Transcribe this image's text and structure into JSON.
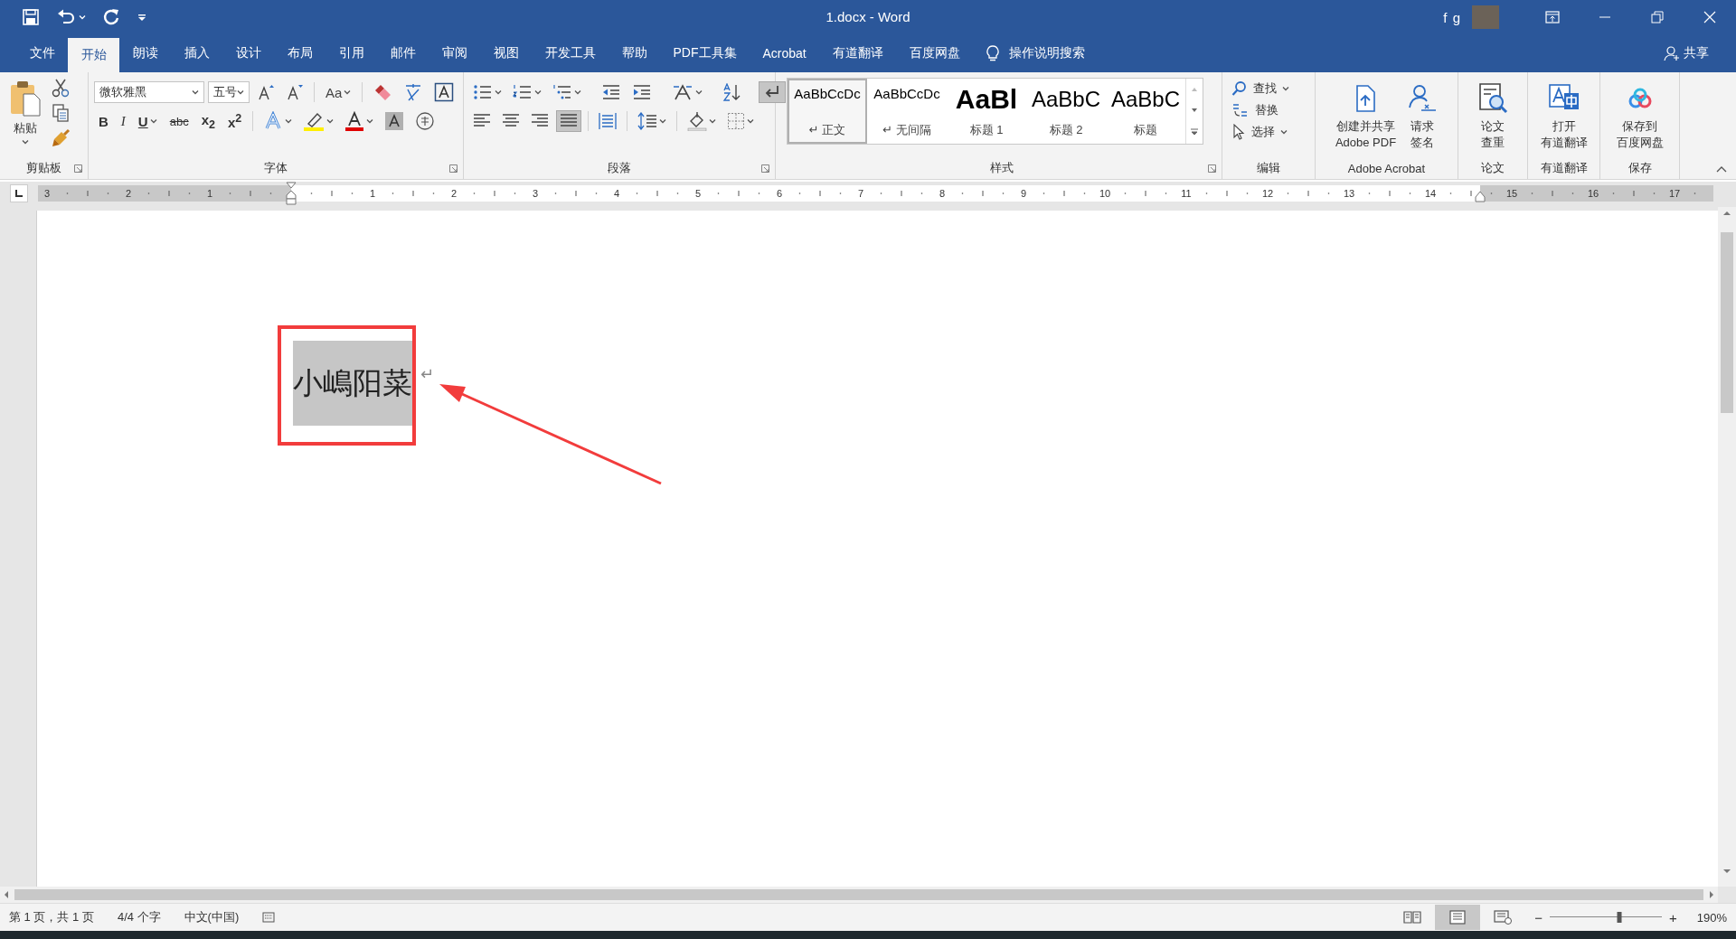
{
  "window": {
    "title": "1.docx  -  Word",
    "user": "f g"
  },
  "quick_access": [
    {
      "kind": "save"
    },
    {
      "kind": "undo"
    },
    {
      "kind": "redo"
    },
    {
      "kind": "customize"
    }
  ],
  "tabs": [
    {
      "label": "文件",
      "selected": false
    },
    {
      "label": "开始",
      "selected": true
    },
    {
      "label": "朗读",
      "selected": false
    },
    {
      "label": "插入",
      "selected": false
    },
    {
      "label": "设计",
      "selected": false
    },
    {
      "label": "布局",
      "selected": false
    },
    {
      "label": "引用",
      "selected": false
    },
    {
      "label": "邮件",
      "selected": false
    },
    {
      "label": "审阅",
      "selected": false
    },
    {
      "label": "视图",
      "selected": false
    },
    {
      "label": "开发工具",
      "selected": false
    },
    {
      "label": "帮助",
      "selected": false
    },
    {
      "label": "PDF工具集",
      "selected": false
    },
    {
      "label": "Acrobat",
      "selected": false
    },
    {
      "label": "有道翻译",
      "selected": false
    },
    {
      "label": "百度网盘",
      "selected": false
    }
  ],
  "tell_me": "操作说明搜索",
  "share": "共享",
  "clipboard": {
    "label": "剪贴板",
    "paste": "粘贴",
    "tools": [
      {
        "kind": "cut"
      },
      {
        "kind": "copy"
      },
      {
        "kind": "format-painter"
      }
    ]
  },
  "font": {
    "label": "字体",
    "name": "微软雅黑",
    "size": "五号",
    "case_button": "Aa",
    "row1": [
      {
        "kind": "grow"
      },
      {
        "kind": "shrink"
      }
    ],
    "row1b": [
      {
        "kind": "clear"
      },
      {
        "kind": "phonetic"
      },
      {
        "kind": "border"
      }
    ],
    "format_buttons": [
      {
        "kind": "bold",
        "text": "B"
      },
      {
        "kind": "italic",
        "text": "I"
      },
      {
        "kind": "underline",
        "text": "U"
      },
      {
        "kind": "strike",
        "text": "abc"
      },
      {
        "kind": "plain",
        "text": "x$_{2}$"
      },
      {
        "kind": "plain",
        "text": "x$^{2}$"
      }
    ],
    "row2": [
      {
        "kind": "effect"
      },
      {
        "kind": "highlight"
      },
      {
        "kind": "font-color"
      },
      {
        "kind": "shading"
      },
      {
        "kind": "enclose"
      }
    ]
  },
  "paragraph": {
    "label": "段落",
    "row1": [
      {
        "kind": "bullets",
        "pressed": false
      },
      {
        "kind": "numbering",
        "pressed": false
      },
      {
        "kind": "multilevel",
        "pressed": false
      },
      {
        "kind": "outdent",
        "pressed": false
      },
      {
        "kind": "indent",
        "pressed": false
      },
      {
        "kind": "asian",
        "pressed": false
      },
      {
        "kind": "sort",
        "pressed": false
      },
      {
        "kind": "marks",
        "pressed": true
      }
    ],
    "row2": [
      {
        "kind": "left",
        "pressed": false
      },
      {
        "kind": "center",
        "pressed": false
      },
      {
        "kind": "right",
        "pressed": false
      },
      {
        "kind": "justify",
        "pressed": true
      },
      {
        "kind": "distribute",
        "pressed": false
      },
      {
        "kind": "spacing",
        "pressed": false
      },
      {
        "kind": "fill",
        "pressed": false
      },
      {
        "kind": "borders",
        "pressed": false
      }
    ]
  },
  "styles": {
    "label": "样式",
    "items": [
      {
        "kind": "normal",
        "preview": "AaBbCcDc",
        "name": "↵ 正文",
        "selected": true
      },
      {
        "kind": "nospace",
        "preview": "AaBbCcDc",
        "name": "↵ 无间隔",
        "selected": false
      },
      {
        "kind": "h1",
        "preview": "AaBl",
        "name": "标题 1",
        "selected": false
      },
      {
        "kind": "h2",
        "preview": "AaBbC",
        "name": "标题 2",
        "selected": false
      },
      {
        "kind": "title",
        "preview": "AaBbC",
        "name": "标题",
        "selected": false
      }
    ]
  },
  "editing": {
    "label": "编辑",
    "items": [
      {
        "kind": "find",
        "text": "查找"
      },
      {
        "kind": "replace",
        "text": "替换"
      },
      {
        "kind": "select",
        "text": "选择"
      }
    ]
  },
  "big_groups": [
    {
      "label": "Adobe Acrobat",
      "buttons": [
        {
          "kind": "pdf",
          "lines": [
            "创建并共享",
            "Adobe PDF"
          ]
        },
        {
          "kind": "sign",
          "lines": [
            "请求",
            "签名"
          ]
        }
      ]
    },
    {
      "label": "论文",
      "buttons": [
        {
          "kind": "paper",
          "lines": [
            "论文",
            "查重"
          ]
        }
      ]
    },
    {
      "label": "有道翻译",
      "buttons": [
        {
          "kind": "translate",
          "lines": [
            "打开",
            "有道翻译"
          ]
        }
      ]
    },
    {
      "label": "保存",
      "buttons": [
        {
          "kind": "cloud",
          "lines": [
            "保存到",
            "百度网盘"
          ]
        }
      ]
    }
  ],
  "ruler": {
    "left_labels": [
      "3",
      "2",
      "1"
    ],
    "right_labels": [
      "1",
      "2",
      "3",
      "4",
      "5",
      "6",
      "7",
      "8",
      "9",
      "10",
      "11",
      "12",
      "13",
      "14",
      "15",
      "16",
      "17"
    ]
  },
  "document": {
    "text": "小嶋阳菜",
    "selected": true,
    "paragraph_mark": "↵"
  },
  "status_bar": {
    "items": [
      "第 1 页，共 1 页",
      "4/4 个字",
      "中文(中国)"
    ],
    "views": [
      {
        "kind": "read",
        "selected": false
      },
      {
        "kind": "print",
        "selected": true
      },
      {
        "kind": "web",
        "selected": false
      }
    ],
    "zoom_out": "−",
    "zoom_in": "+",
    "zoom": {
      "level": 0.62
    },
    "zoom_text": "190%"
  }
}
